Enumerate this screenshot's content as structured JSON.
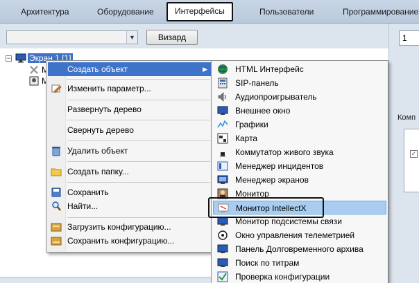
{
  "tabs": [
    {
      "label": "Архитектура",
      "active": false
    },
    {
      "label": "Оборудование",
      "active": false
    },
    {
      "label": "Интерфейсы",
      "active": true
    },
    {
      "label": "Пользователи",
      "active": false
    },
    {
      "label": "Программирование",
      "active": false
    }
  ],
  "toolbar": {
    "combo_value": "",
    "wizard_label": "Визард"
  },
  "tree": {
    "root_label": "Экран 1 [1]",
    "child1_label": "М",
    "child2_label": "М"
  },
  "context_menu": {
    "items": [
      {
        "label": "Создать объект",
        "icon": "none",
        "has_submenu": true
      },
      {
        "label": "Изменить параметр...",
        "icon": "edit-icon"
      },
      {
        "label": "Развернуть дерево",
        "icon": "none"
      },
      {
        "label": "Свернуть дерево",
        "icon": "none"
      },
      {
        "label": "Удалить объект",
        "icon": "delete-icon"
      },
      {
        "label": "Создать папку...",
        "icon": "folder-icon"
      },
      {
        "label": "Сохранить",
        "icon": "save-icon"
      },
      {
        "label": "Найти...",
        "icon": "find-icon"
      },
      {
        "label": "Загрузить конфигурацию...",
        "icon": "load-config-icon"
      },
      {
        "label": "Сохранить конфигурацию...",
        "icon": "save-config-icon"
      }
    ]
  },
  "submenu": {
    "items": [
      {
        "label": "HTML Интерфейс",
        "icon": "globe-icon"
      },
      {
        "label": "SIP-панель",
        "icon": "sip-panel-icon"
      },
      {
        "label": "Аудиопроигрыватель",
        "icon": "speaker-icon"
      },
      {
        "label": "Внешнее окно",
        "icon": "window-icon"
      },
      {
        "label": "Графики",
        "icon": "chart-icon"
      },
      {
        "label": "Карта",
        "icon": "map-icon"
      },
      {
        "label": "Коммутатор живого звука",
        "icon": "audio-switch-icon"
      },
      {
        "label": "Менеджер инцидентов",
        "icon": "incident-icon"
      },
      {
        "label": "Менеджер экранов",
        "icon": "screen-manager-icon"
      },
      {
        "label": "Монитор",
        "icon": "monitor-icon"
      },
      {
        "label": "Монитор IntellectX",
        "icon": "intellectx-monitor-icon"
      },
      {
        "label": "Монитор подсистемы связи",
        "icon": "comm-monitor-icon"
      },
      {
        "label": "Окно управления телеметрией",
        "icon": "telemetry-icon"
      },
      {
        "label": "Панель Долговременного архива",
        "icon": "archive-panel-icon"
      },
      {
        "label": "Поиск по титрам",
        "icon": "titles-search-icon"
      },
      {
        "label": "Проверка конфигурации",
        "icon": "config-check-icon"
      }
    ]
  },
  "right_panel": {
    "field_value": "1",
    "label": "Комп"
  },
  "colors": {
    "accent_highlight": "#3d74c9",
    "submenu_highlight": "#a8cdf0",
    "tab_bar": "#c8d6e6",
    "panel_bg": "#dce4ee"
  }
}
